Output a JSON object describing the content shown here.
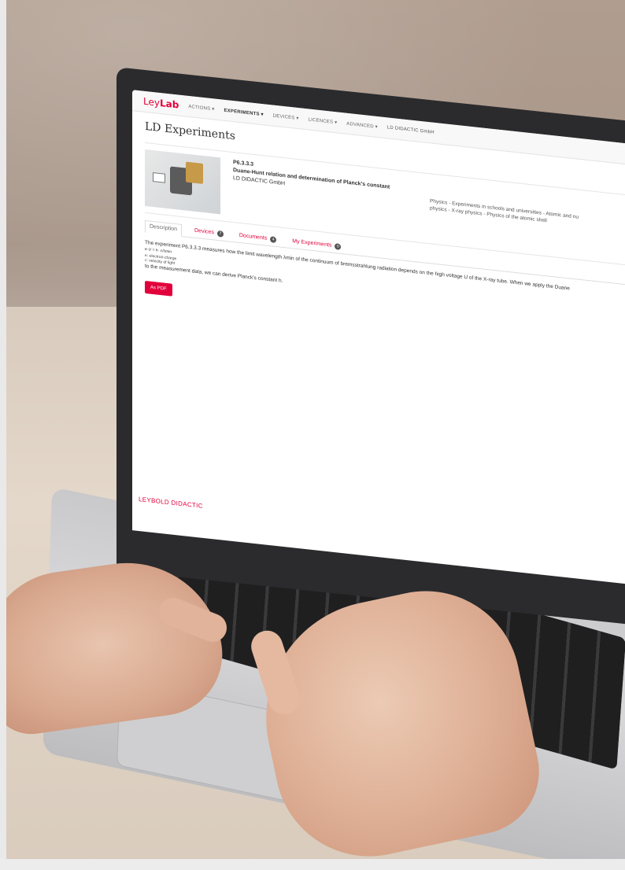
{
  "app": {
    "logo_ley": "Ley",
    "logo_lab": "Lab",
    "nav": [
      "ACTIONS ▾",
      "EXPERIMENTS ▾",
      "DEVICES ▾",
      "LICENCES ▾",
      "ADVANCED ▾"
    ],
    "org": "LD DIDACTIC GmbH"
  },
  "page_title": "LD Experiments",
  "experiment": {
    "code": "P6.3.3.3",
    "title": "Duane-Hunt relation and determination of Planck's constant",
    "publisher": "LD DIDACTIC GmbH",
    "category_line1": "Physics - Experiments in schools and universities - Atomic and nu",
    "category_line2": "physics - X-ray physics - Physics of the atomic shell"
  },
  "tabs": [
    {
      "label": "Description",
      "badge": ""
    },
    {
      "label": "Devices",
      "badge": "7"
    },
    {
      "label": "Documents",
      "badge": "4"
    },
    {
      "label": "My Experiments",
      "badge": "0"
    }
  ],
  "description": {
    "line1": "The experiment P6.3.3.3 measures how the limit wavelength λmin of the continuum of bremsstrahlung radiation depends on the high voltage U of the X-ray tube. When we apply the Duane",
    "formula": "e·U = h· c/λmin",
    "legend1": "e: electron-charge",
    "legend2": "c: velocity of light",
    "line2": "to the measurement data, we can derive Planck's constant h."
  },
  "pdf_button": "As PDF",
  "brand_footer": "LEYBOLD DIDACTIC",
  "colors": {
    "accent": "#e2003b"
  }
}
